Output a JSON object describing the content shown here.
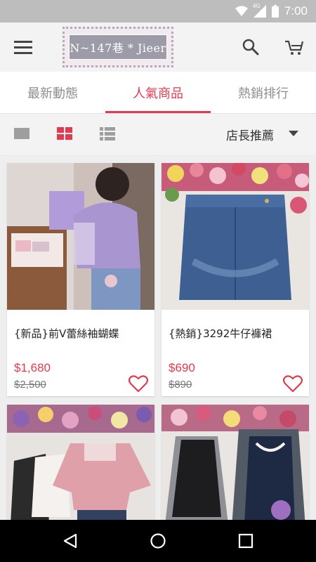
{
  "status_bar": {
    "time": "7:00",
    "network": "4G"
  },
  "app_bar": {
    "menu_icon": "hamburger-menu-icon",
    "logo_text": "N~147巷 * Jieer",
    "search_icon": "search-icon",
    "cart_icon": "cart-icon"
  },
  "tabs": [
    {
      "label": "最新動態",
      "active": false
    },
    {
      "label": "人氣商品",
      "active": true
    },
    {
      "label": "熱銷排行",
      "active": false
    }
  ],
  "toolbar": {
    "views": [
      "single-view-icon",
      "grid-view-icon",
      "list-view-icon"
    ],
    "active_view": "grid-view-icon",
    "sort_label": "店長推薦"
  },
  "products": [
    {
      "name": "{新品}前V蕾絲袖蝴蝶",
      "price": "$1,680",
      "original_price": "$2,500"
    },
    {
      "name": "{熱銷}3292牛仔褲裙",
      "price": "$690",
      "original_price": "$890"
    }
  ],
  "colors": {
    "accent": "#e53950",
    "toolbar_bg": "#f3f3f3",
    "page_bg": "#eeeeee"
  },
  "nav_bar": [
    "back-icon",
    "home-icon",
    "recents-icon"
  ]
}
